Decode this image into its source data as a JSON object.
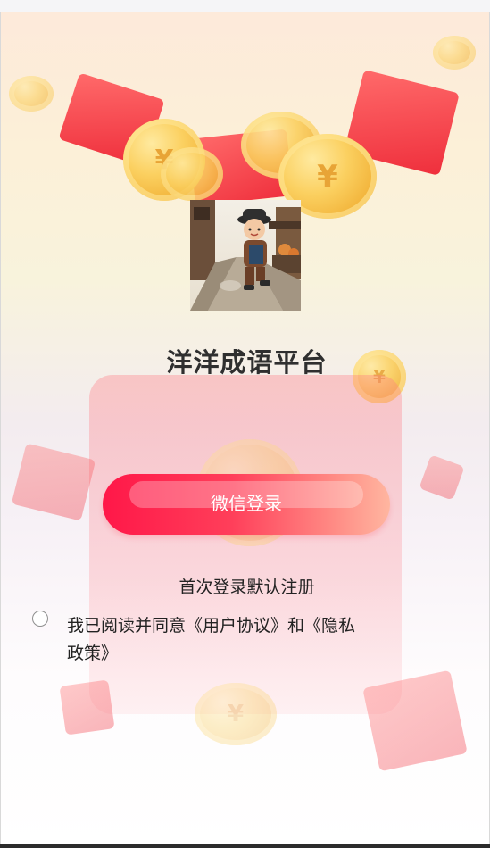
{
  "app": {
    "title": "洋洋成语平台"
  },
  "login": {
    "button_label": "微信登录",
    "hint": "首次登录默认注册"
  },
  "agreement": {
    "prefix": "我已阅读并同意",
    "user_agreement": "《用户协议》",
    "conjunction": "和",
    "privacy_policy": "《隐私政策》",
    "checked": false
  },
  "colors": {
    "button_start": "#ff1748",
    "button_end": "#ffb6a0",
    "envelope_red": "#ef2f3c",
    "coin_gold": "#f2b43b"
  },
  "icons": {
    "coin": "yuan-coin-icon",
    "envelope": "red-envelope-icon"
  }
}
